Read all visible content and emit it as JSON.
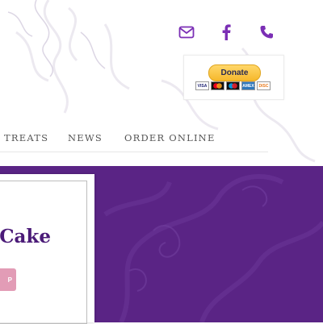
{
  "header": {
    "social": {
      "mail_icon": "envelope-icon",
      "facebook_icon": "facebook-icon",
      "phone_icon": "phone-icon",
      "icon_color": "#7b2fb5"
    },
    "donate": {
      "button_label": "Donate",
      "cards": [
        "VISA",
        "",
        "",
        "AMEX",
        "DISC"
      ]
    }
  },
  "nav": {
    "items": [
      "TREATS",
      "NEWS",
      "ORDER ONLINE"
    ]
  },
  "hero": {
    "background_color": "#5a2485",
    "headline": "y Cake!",
    "button_label": "P",
    "button_color": "#e29cb6",
    "headline_color": "#4b1b78"
  }
}
